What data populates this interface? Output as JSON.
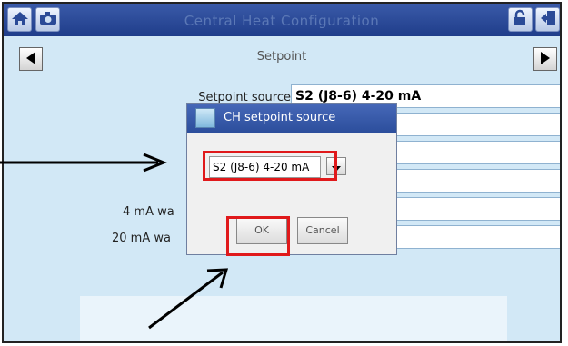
{
  "window": {
    "title": "Central Heat Configuration"
  },
  "icons": {
    "home": "home-icon",
    "camera": "camera-icon",
    "unlock": "unlock-icon",
    "exit": "exit-door-icon"
  },
  "nav": {
    "section": "Setpoint"
  },
  "form": {
    "setpoint_source_label": "Setpoint source",
    "setpoint_source_value": "S2 (J8-6) 4-20 mA",
    "label_4ma": "4 mA wa",
    "label_20ma": "20 mA wa"
  },
  "dialog": {
    "title": "CH setpoint source",
    "selected": "S2 (J8-6) 4-20 mA",
    "ok": "OK",
    "cancel": "Cancel"
  },
  "colors": {
    "titlebar": "#2b4a97",
    "background": "#d2e8f6",
    "highlight": "#e0191b"
  }
}
